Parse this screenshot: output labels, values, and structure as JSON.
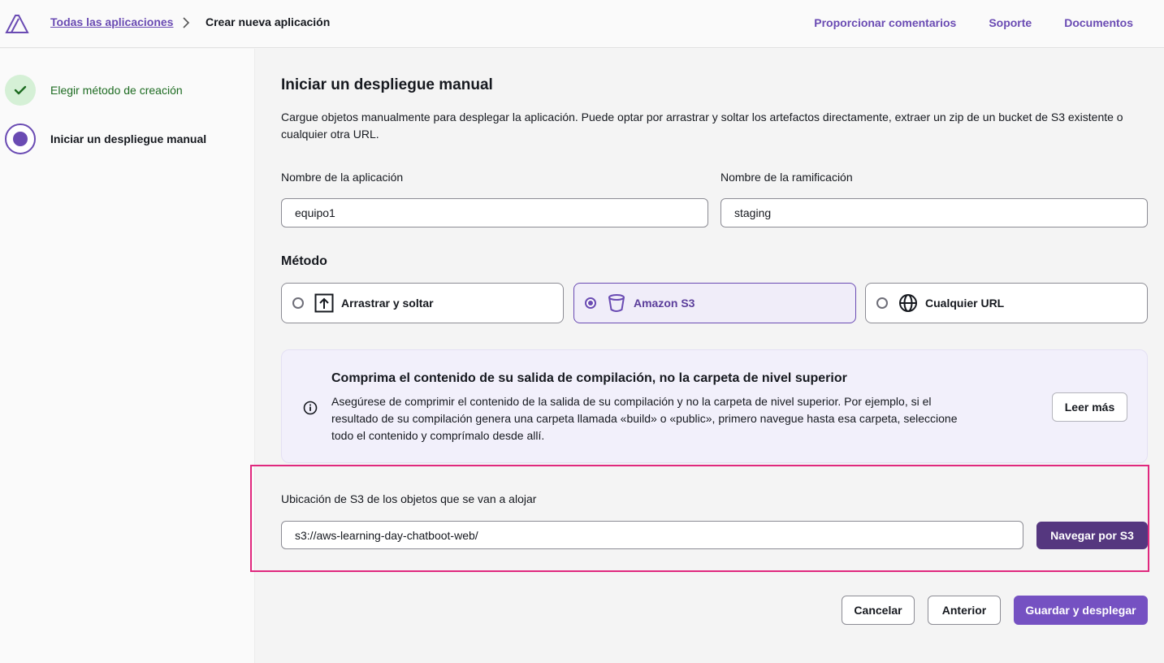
{
  "header": {
    "breadcrumb_link": "Todas las aplicaciones",
    "breadcrumb_current": "Crear nueva aplicación",
    "nav": [
      "Proporcionar comentarios",
      "Soporte",
      "Documentos"
    ]
  },
  "sidebar": {
    "steps": [
      {
        "label": "Elegir método de creación",
        "state": "completed",
        "icon": "check-icon"
      },
      {
        "label": "Iniciar un despliegue manual",
        "state": "current",
        "icon": "current-step-dot"
      }
    ]
  },
  "main": {
    "title": "Iniciar un despliegue manual",
    "description": "Cargue objetos manualmente para desplegar la aplicación. Puede optar por arrastrar y soltar los artefactos directamente, extraer un zip de un bucket de S3 existente o cualquier otra URL.",
    "app_name": {
      "label": "Nombre de la aplicación",
      "value": "equipo1"
    },
    "branch_name": {
      "label": "Nombre de la ramificación",
      "value": "staging"
    },
    "method": {
      "title": "Método",
      "options": [
        {
          "label": "Arrastrar y soltar",
          "icon": "upload-icon",
          "selected": false
        },
        {
          "label": "Amazon S3",
          "icon": "bucket-icon",
          "selected": true
        },
        {
          "label": "Cualquier URL",
          "icon": "globe-icon",
          "selected": false
        }
      ]
    },
    "alert": {
      "title": "Comprima el contenido de su salida de compilación, no la carpeta de nivel superior",
      "body": "Asegúrese de comprimir el contenido de la salida de su compilación y no la carpeta de nivel superior. Por ejemplo, si el resultado de su compilación genera una carpeta llamada «build» o «public», primero navegue hasta esa carpeta, seleccione todo el contenido y comprímalo desde allí.",
      "button": "Leer más",
      "icon": "info-icon"
    },
    "s3_location": {
      "label": "Ubicación de S3 de los objetos que se van a alojar",
      "value": "s3://aws-learning-day-chatboot-web/",
      "browse_button": "Navegar por S3"
    },
    "footer": {
      "cancel": "Cancelar",
      "previous": "Anterior",
      "save_deploy": "Guardar y desplegar"
    }
  },
  "colors": {
    "accent": "#6a4bb3",
    "primary_button": "#7551c2",
    "dark_button": "#55377f",
    "highlight_border": "#e0287e",
    "completed_green": "#1d6b21"
  }
}
